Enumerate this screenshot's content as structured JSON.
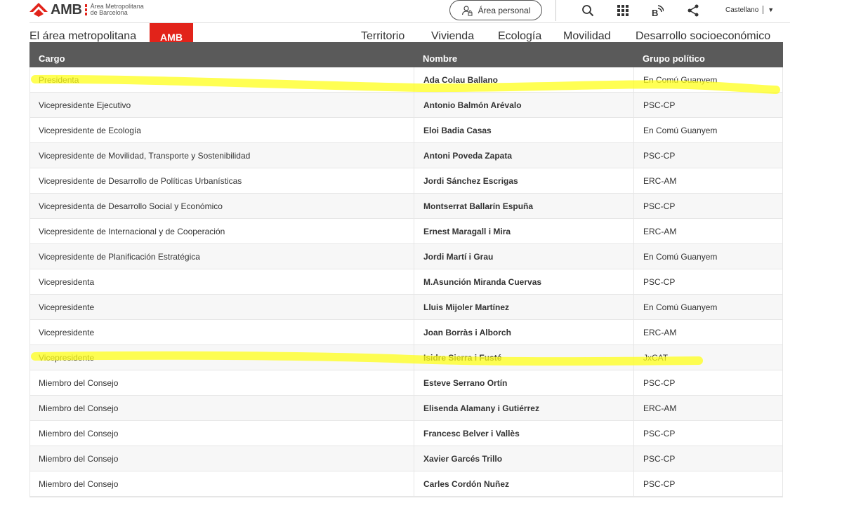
{
  "header": {
    "logo_text": "AMB",
    "logo_sub_line1": "Àrea Metropolitana",
    "logo_sub_line2": "de Barcelona",
    "personal_label": "Área personal",
    "language": "Castellano"
  },
  "colors": {
    "brand": "#e2231a",
    "table_header": "#5a5a5a",
    "highlight": "#ffff1a"
  },
  "icons": [
    "person-lock-icon",
    "search-icon",
    "apps-grid-icon",
    "rss-icon",
    "share-icon",
    "chevron-down-icon"
  ],
  "nav": {
    "left_item": "El área metropolitana",
    "active_item": "AMB",
    "items": [
      "Territorio",
      "Vivienda",
      "Ecología",
      "Movilidad",
      "Desarrollo socioeconómico"
    ]
  },
  "table": {
    "headers": [
      "Cargo",
      "Nombre",
      "Grupo político"
    ],
    "rows": [
      {
        "cargo": "Presidenta",
        "nombre": "Ada Colau Ballano",
        "grupo": "En Comú Guanyem"
      },
      {
        "cargo": "Vicepresidente Ejecutivo",
        "nombre": "Antonio Balmón Arévalo",
        "grupo": "PSC-CP"
      },
      {
        "cargo": "Vicepresidente de Ecología",
        "nombre": "Eloi Badia Casas",
        "grupo": "En Comú Guanyem"
      },
      {
        "cargo": "Vicepresidente de Movilidad, Transporte y Sostenibilidad",
        "nombre": "Antoni Poveda Zapata",
        "grupo": "PSC-CP"
      },
      {
        "cargo": "Vicepresidente de Desarrollo de Políticas Urbanísticas",
        "nombre": "Jordi Sánchez Escrigas",
        "grupo": "ERC-AM"
      },
      {
        "cargo": "Vicepresidenta de Desarrollo Social y Económico",
        "nombre": "Montserrat Ballarín Espuña",
        "grupo": "PSC-CP"
      },
      {
        "cargo": "Vicepresidente de Internacional y de Cooperación",
        "nombre": "Ernest Maragall i Mira",
        "grupo": "ERC-AM"
      },
      {
        "cargo": "Vicepresidente de Planificación Estratégica",
        "nombre": "Jordi Martí i Grau",
        "grupo": "En Comú Guanyem"
      },
      {
        "cargo": "Vicepresidenta",
        "nombre": "M.Asunción Miranda Cuervas",
        "grupo": "PSC-CP"
      },
      {
        "cargo": "Vicepresidente",
        "nombre": "Lluis Mijoler Martínez",
        "grupo": "En Comú Guanyem"
      },
      {
        "cargo": "Vicepresidente",
        "nombre": "Joan Borràs i Alborch",
        "grupo": "ERC-AM"
      },
      {
        "cargo": "Vicepresidente",
        "nombre": "Isidre Sierra i Fusté",
        "grupo": "JxCAT"
      },
      {
        "cargo": "Miembro del Consejo",
        "nombre": "Esteve Serrano Ortín",
        "grupo": "PSC-CP"
      },
      {
        "cargo": "Miembro del Consejo",
        "nombre": "Elisenda Alamany i Gutiérrez",
        "grupo": "ERC-AM"
      },
      {
        "cargo": "Miembro del Consejo",
        "nombre": "Francesc Belver i Vallès",
        "grupo": "PSC-CP"
      },
      {
        "cargo": "Miembro del Consejo",
        "nombre": "Xavier Garcés Trillo",
        "grupo": "PSC-CP"
      },
      {
        "cargo": "Miembro del Consejo",
        "nombre": "Carles Cordón Nuñez",
        "grupo": "PSC-CP"
      }
    ]
  }
}
